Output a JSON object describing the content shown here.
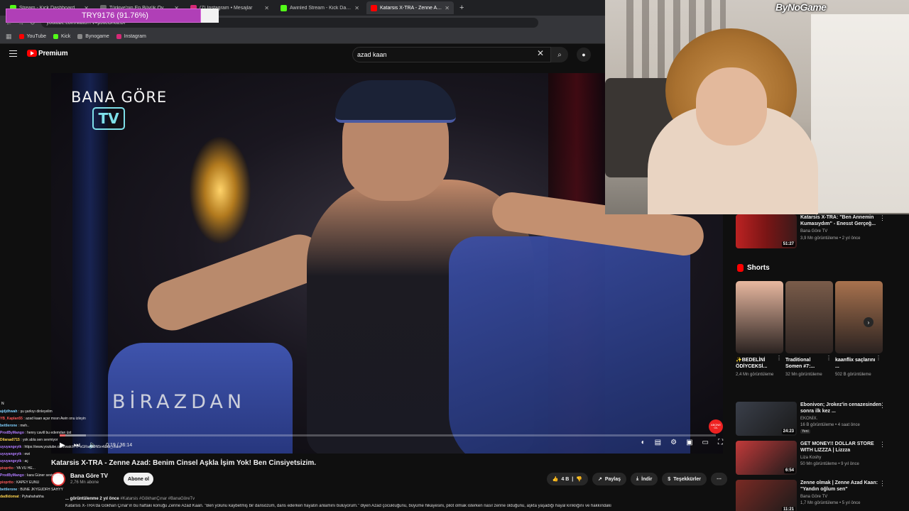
{
  "browser": {
    "tabs": [
      {
        "label": "Stream - Kick Dashboard",
        "color": "#53fc18",
        "active": false
      },
      {
        "label": "Türkiye'nin En Büyük Oyuncu D",
        "color": "#6a6a6a",
        "active": false
      },
      {
        "label": "(7) Instagram • Mesajlar",
        "color": "#d62976",
        "active": false
      },
      {
        "label": "Awinled Stream - Kick Dashbo",
        "color": "#53fc18",
        "active": false
      },
      {
        "label": "Katarsis X-TRA - Zenne Azad: B",
        "color": "#ff0000",
        "active": true
      }
    ],
    "url": "youtube.com/watch?v=pJtlcOnoZDI",
    "bookmarks": [
      "YouTube",
      "Kick",
      "Bynogame",
      "Instagram"
    ]
  },
  "goal": {
    "text": "TRY9176 (91.76%)",
    "progress": 0.9176
  },
  "youtube": {
    "logo_label": "Premium",
    "search_query": "azad kaan"
  },
  "video": {
    "brand_text": "BANA GÖRE",
    "brand_tv": "TV",
    "overlay_text": "BİRAZDAN",
    "subscribe_badge": "ABONE OL",
    "time_current": "0:19",
    "time_total": "36:14",
    "progress": 0.0087,
    "title": "Katarsis X-TRA - Zenne Azad: Benim Cinsel Aşkla İşim Yok! Ben Cinsiyetsizim.",
    "channel_name": "Bana Göre TV",
    "channel_subs": "2,76 Mn abone",
    "subscribe_label": "Abone ol",
    "likes": "4 B",
    "share_label": "Paylaş",
    "download_label": "İndir",
    "thanks_label": "Teşekkürler",
    "meta_views": "... görüntülenme  2 yıl önce",
    "meta_tags": "#Katarsis #GökhanÇınar #BanaGöreTv",
    "description": "Katarsis X-TRA'da Gökhan Çınar'ın bu haftaki konuğu Zenne Azad Kaan. \"Ben yolunu kaybetmiş bir dansözüm, dans ederken hayatın anlamını buluyorum.\" diyen Azad çocukluğunu, büyüme hikayesini, pilot olmak isterken nasıl zenne olduğunu, aşkta yaşadığı hayal kırıklığını ve hakkındaki"
  },
  "chat": [
    {
      "user": "ajdjdhwah",
      "msg": "şu şarkıyı dinleyelim",
      "color": "#7fd1ff"
    },
    {
      "user": "YB_Kaplan55",
      "msg": "azad kaan açar mısın Awin onu izleyin",
      "color": "#ff5a5a"
    },
    {
      "user": "bettlerone",
      "msg": "meh..",
      "color": "#7fd1ff"
    },
    {
      "user": "ProdByMango",
      "msg": "henry cavill bu edemdan üst",
      "color": "#b07bff"
    },
    {
      "user": "Dilaraa0715",
      "msg": "yok abla sen sevmiyor",
      "color": "#ffd54f"
    },
    {
      "user": "uyuyangeyik",
      "msg": "https://www.youtube.com/watch?v=sGRsAsDN5n4&ab_channel=osmener%C3%A7n",
      "color": "#b07bff"
    },
    {
      "user": "uyuyangeyik",
      "msg": "ewi",
      "color": "#b07bff"
    },
    {
      "user": "uyuyangeyik",
      "msg": "aç",
      "color": "#b07bff"
    },
    {
      "user": "pioprtto",
      "msg": "YA VU HE...",
      "color": "#ff5a5a"
    },
    {
      "user": "ProdByMango",
      "msg": "kara Güner seviyo beni",
      "color": "#b07bff"
    },
    {
      "user": "pioprtto",
      "msg": "KAPEY EUNU",
      "color": "#ff5a5a"
    },
    {
      "user": "bettlerone",
      "msg": "BUNE JKYGUDFH SAHYY",
      "color": "#7fd1ff"
    },
    {
      "user": "dadlidomat",
      "msg": "Pyhahahahha",
      "color": "#ffd54f"
    }
  ],
  "webcam": {
    "brand": "ByNoGame"
  },
  "sidebar": {
    "top_rec": {
      "title": "Katarsis X-TRA: \"Ben Annemin Kumasıydım\" - Enesst Gerçeğ...",
      "channel": "Bana Göre TV",
      "views": "3,9 Mn görüntüleme • 2 yıl önce",
      "duration": "51:27"
    },
    "shorts_label": "Shorts",
    "shorts": [
      {
        "title": "✨BEDELİNİ ÖDİYCEKSİ...",
        "views": "2,4 Mn görüntüleme",
        "color": "#e8b8a0"
      },
      {
        "title": "Traditional Somen #7:...",
        "views": "32 Mn görüntüleme",
        "color": "#7a5c4a"
      },
      {
        "title": "kaanflix saçlarını ...",
        "views": "502 B görüntüleme",
        "color": "#a8724e"
      }
    ],
    "recs": [
      {
        "title": "Ebonivon; Jrokez'in cenazesinden sonra ilk kez ...",
        "channel": "EKONİX.",
        "views": "16 B görüntüleme • 4 saat önce",
        "extra": "Yeni",
        "duration": "24:23",
        "color": "#3a3f4a"
      },
      {
        "title": "GET MONEY!! DOLLAR STORE WITH LIZZZA | Lizzza",
        "channel": "Liza Koshy",
        "views": "50 Mn görüntüleme • 9 yıl önce",
        "extra": "",
        "duration": "6:54",
        "color": "#c23a3a"
      },
      {
        "title": "Zenne olmak | Zenne Azad Kaan: \"Yandın oğlum sen\"",
        "channel": "Bana Göre TV",
        "views": "1,7 Mn görüntüleme • 5 yıl önce",
        "extra": "",
        "duration": "11:21",
        "color": "#7a2a24"
      }
    ]
  }
}
